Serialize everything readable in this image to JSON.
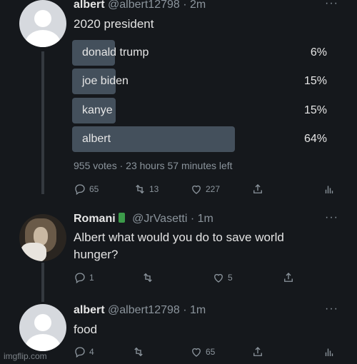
{
  "tweets": [
    {
      "name": "albert",
      "handle": "@albert12798",
      "time": "· 2m",
      "text": "2020 president",
      "poll": {
        "options": [
          {
            "label": "donald trump",
            "pct": "6%",
            "fraction": 0.06
          },
          {
            "label": "joe biden",
            "pct": "15%",
            "fraction": 0.15
          },
          {
            "label": "kanye",
            "pct": "15%",
            "fraction": 0.15
          },
          {
            "label": "albert",
            "pct": "64%",
            "fraction": 0.64
          }
        ],
        "meta": "955 votes · 23 hours 57 minutes left"
      },
      "actions": {
        "replies": "65",
        "retweets": "13",
        "likes": "227",
        "share": "",
        "analytics": ""
      }
    },
    {
      "name": "Romani",
      "handle": "@JrVasetti",
      "time": "· 1m",
      "text": "Albert what would you do to save world hunger?",
      "actions": {
        "replies": "1",
        "retweets": "",
        "likes": "5",
        "share": ""
      }
    },
    {
      "name": "albert",
      "handle": "@albert12798",
      "time": "· 1m",
      "text": "food",
      "actions": {
        "replies": "4",
        "retweets": "",
        "likes": "65",
        "share": "",
        "analytics": ""
      }
    }
  ],
  "more_label": "···",
  "watermark": "imgflip.com"
}
